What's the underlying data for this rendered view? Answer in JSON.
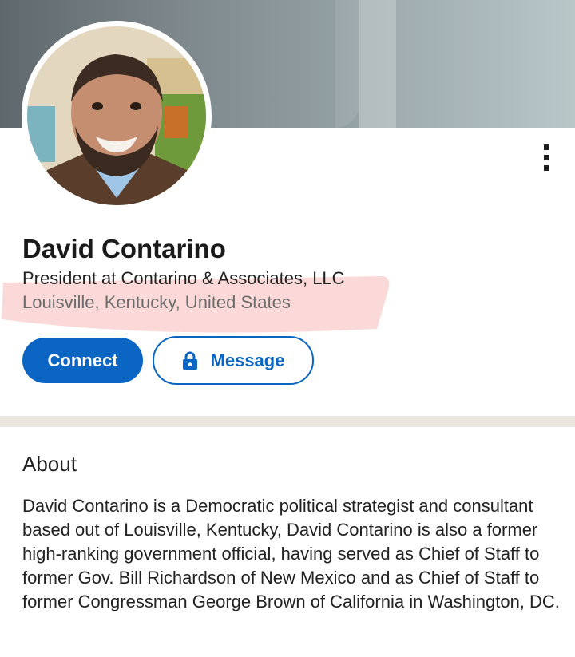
{
  "profile": {
    "name": "David Contarino",
    "headline": "President at Contarino & Associates, LLC",
    "location": "Louisville, Kentucky, United States"
  },
  "actions": {
    "connect_label": "Connect",
    "message_label": "Message",
    "more_icon": "more-vertical-icon",
    "lock_icon": "lock-icon"
  },
  "about": {
    "title": "About",
    "body": "David Contarino is a Democratic political strategist and consultant based out of Louisville, Kentucky, David Contarino is also a former high-ranking government official, having served as Chief of Staff to former Gov. Bill Richardson of New Mexico and as Chief of Staff to former Congressman George Brown of California in Washington, DC."
  },
  "colors": {
    "brand": "#0a66c2",
    "highlight": "#fbd2d2",
    "divider": "#ebe5df"
  }
}
